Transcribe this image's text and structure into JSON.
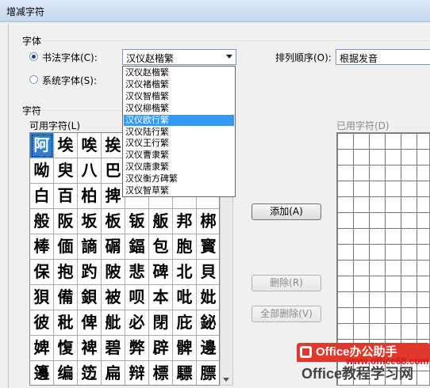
{
  "window": {
    "title": "增减字符"
  },
  "font_group": {
    "label": "字体",
    "calligraphy_radio": "书法字体(C):",
    "calligraphy_selected": true,
    "system_radio": "系统字体(S):",
    "font_combo_value": "汉仪赵楷繁",
    "sort_label": "排列顺序(O):",
    "sort_value": "根据发音"
  },
  "dropdown": {
    "items": [
      "汉仪赵楷繁",
      "汉仪褚楷繁",
      "汉仪智楷繁",
      "汉仪柳楷繁",
      "汉仪欧行繁",
      "汉仪陆行繁",
      "汉仪王行繁",
      "汉仪曹隶繁",
      "汉仪唐隶繁",
      "汉仪衡方碑繁",
      "汉仪智草繁"
    ],
    "selected_index": 4
  },
  "chars_group": {
    "label": "字符",
    "available_label": "可用字符(L)",
    "used_label": "已用字符(D)"
  },
  "char_rows": [
    [
      "阿",
      "埃",
      "唉",
      "挨",
      "",
      "",
      "",
      ""
    ],
    [
      "呦",
      "臾",
      "八",
      "巴",
      "",
      "",
      "",
      ""
    ],
    [
      "白",
      "百",
      "柏",
      "捭",
      "",
      "",
      "",
      ""
    ],
    [
      "般",
      "阪",
      "坂",
      "板",
      "钣",
      "舨",
      "邦",
      "梆"
    ],
    [
      "棒",
      "偭",
      "謪",
      "碿",
      "鍢",
      "包",
      "胞",
      "寳"
    ],
    [
      "保",
      "抱",
      "趵",
      "陂",
      "悲",
      "碑",
      "北",
      "貝"
    ],
    [
      "狽",
      "備",
      "鋇",
      "被",
      "呗",
      "本",
      "吡",
      "妣"
    ],
    [
      "彼",
      "秕",
      "俾",
      "舭",
      "必",
      "閉",
      "庇",
      "鉍"
    ],
    [
      "婢",
      "愎",
      "裨",
      "碧",
      "弊",
      "辟",
      "髀",
      "邊"
    ],
    [
      "籩",
      "编",
      "笾",
      "扁",
      "辩",
      "標",
      "驃",
      "膘"
    ]
  ],
  "buttons": {
    "add": "添加(A)",
    "delete": "删除(R)",
    "delete_all": "全部删除(V)"
  },
  "watermark": {
    "brand": "Office办公助手",
    "sub": "Office教程学习网",
    "url": "www.office68.com"
  }
}
